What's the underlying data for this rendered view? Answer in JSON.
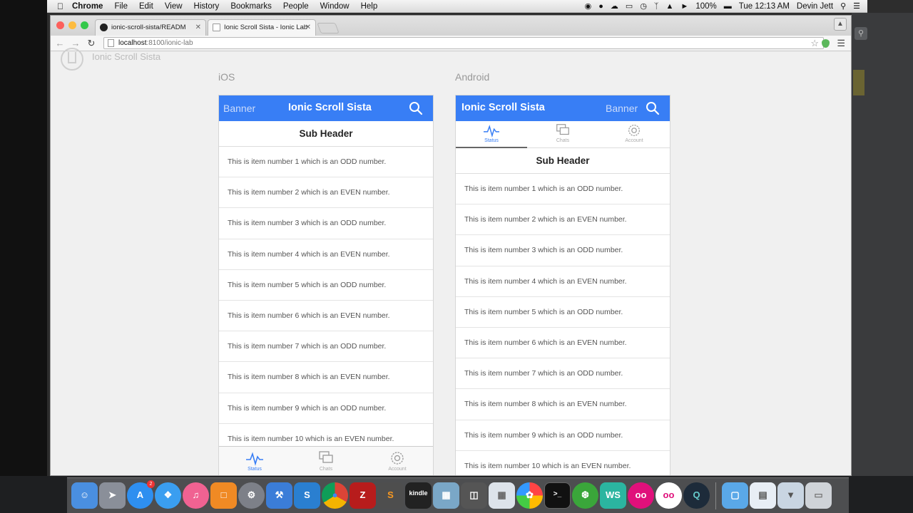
{
  "menubar": {
    "items": [
      "Chrome",
      "File",
      "Edit",
      "View",
      "History",
      "Bookmarks",
      "People",
      "Window",
      "Help"
    ],
    "battery": "100%",
    "clock": "Tue 12:13 AM",
    "user": "Devin Jett"
  },
  "browser": {
    "tabs": [
      {
        "title": "ionic-scroll-sista/READM"
      },
      {
        "title": "Ionic Scroll Sista - Ionic Lab"
      }
    ],
    "url_host": "localhost",
    "url_path": ":8100/ionic-lab"
  },
  "lab": {
    "title": "Ionic Scroll Sista",
    "platforms": [
      "iOS",
      "Android"
    ]
  },
  "app": {
    "title": "Ionic Scroll Sista",
    "banner": "Banner",
    "subheader": "Sub Header",
    "tabs": [
      "Status",
      "Chats",
      "Account"
    ],
    "items": [
      "This is item number 1 which is an ODD number.",
      "This is item number 2 which is an EVEN number.",
      "This is item number 3 which is an ODD number.",
      "This is item number 4 which is an EVEN number.",
      "This is item number 5 which is an ODD number.",
      "This is item number 6 which is an EVEN number.",
      "This is item number 7 which is an ODD number.",
      "This is item number 8 which is an EVEN number.",
      "This is item number 9 which is an ODD number.",
      "This is item number 10 which is an EVEN number."
    ],
    "accent": "#387ef5"
  },
  "dock": {
    "apps": [
      "finder-icon",
      "launchpad-icon",
      "app-store-icon",
      "safari-icon",
      "itunes-icon",
      "ibooks-icon",
      "system-preferences-icon",
      "xcode-icon",
      "scrivener-icon",
      "chrome-icon",
      "filezilla-icon",
      "sublime-text-icon",
      "kindle-icon",
      "preview-icon",
      "directory-utility-icon",
      "photos-icon",
      "calculator-icon",
      "terminal-icon",
      "camtasia-icon",
      "webstorm-icon",
      "flickr-icon",
      "flickr-uploader-icon",
      "quicktime-icon",
      "folder-icon",
      "documents-icon",
      "downloads-icon",
      "trash-icon"
    ],
    "badge": "2",
    "kindle_label": "kindle"
  }
}
